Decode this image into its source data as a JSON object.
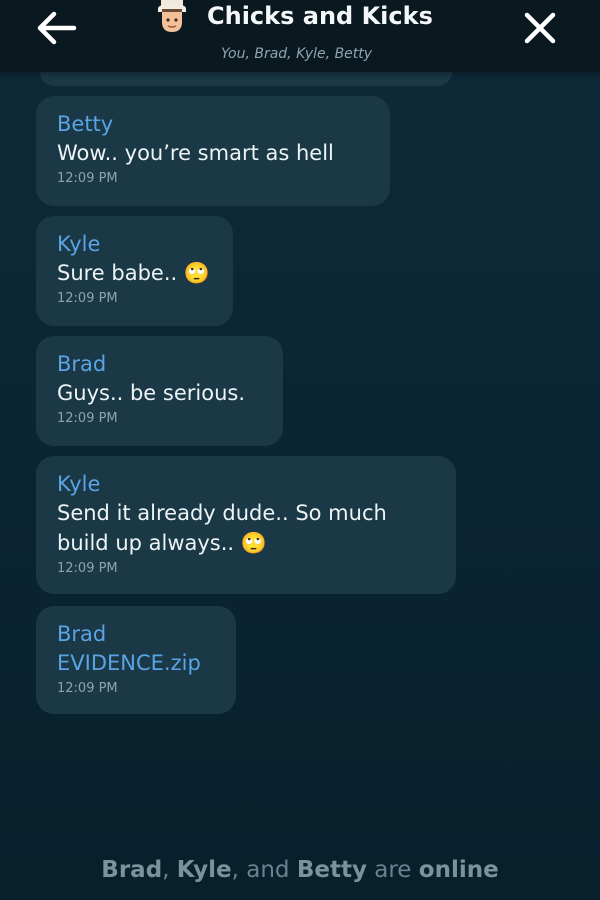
{
  "header": {
    "title": "Chicks and Kicks",
    "subtitle": "You, Brad, Kyle, Betty",
    "back_icon": "arrow-left-icon",
    "close_icon": "close-icon",
    "avatar": "group-avatar"
  },
  "messages": [
    {
      "sender": "Betty",
      "text": "Wow.. you’re smart as hell",
      "time": "12:09 PM"
    },
    {
      "sender": "Kyle",
      "text": "Sure babe.. 🙄",
      "time": "12:09 PM"
    },
    {
      "sender": "Brad",
      "text": "Guys.. be serious.",
      "time": "12:09 PM"
    },
    {
      "sender": "Kyle",
      "text": "Send it already dude.. So much\nbuild up always.. 🙄",
      "time": "12:09 PM"
    },
    {
      "sender": "Brad",
      "text": "EVIDENCE.zip",
      "time": "12:09 PM",
      "is_file": true
    }
  ],
  "footer": {
    "name1": "Brad",
    "sep1": ", ",
    "name2": "Kyle",
    "sep2": ", and ",
    "name3": "Betty",
    "are": " are ",
    "status": "online"
  },
  "colors": {
    "background": "#0b2633",
    "header": "#0a1820",
    "bubble": "#1a3846",
    "sender": "#5aa4e6",
    "text": "#eef3f5",
    "timestamp": "#8ea3ae"
  }
}
